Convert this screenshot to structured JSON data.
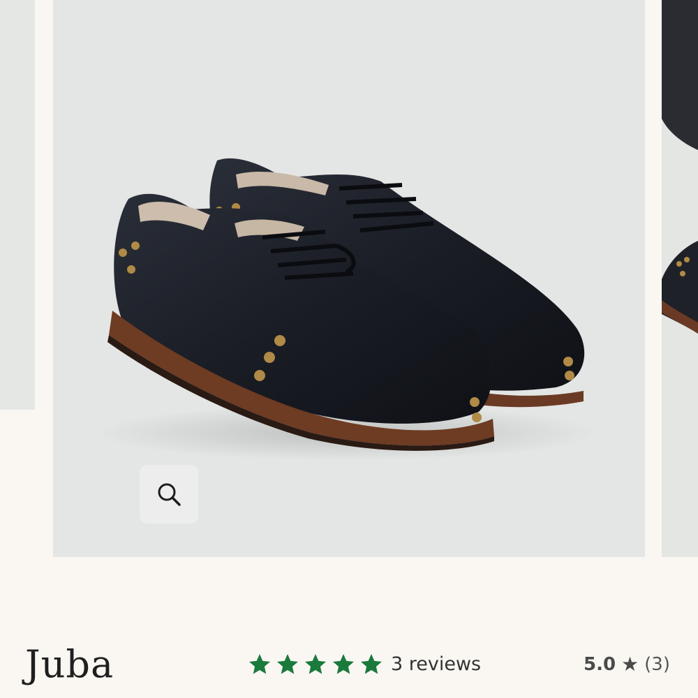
{
  "carousel": {
    "zoom_icon": "search-icon"
  },
  "product": {
    "title": "Juba",
    "stars_icon": "star-icon",
    "stars_count": 5,
    "stars_color": "#1a7a3c",
    "reviews_label": "3 reviews",
    "rating_value": "5.0",
    "rating_star": "★",
    "rating_count": "(3)"
  }
}
